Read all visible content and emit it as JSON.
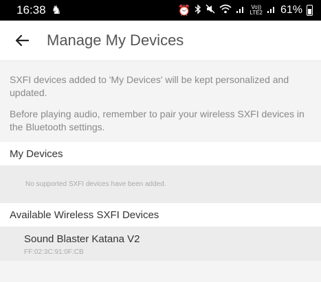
{
  "status_bar": {
    "time": "16:38",
    "left_icons": [
      "knight-icon"
    ],
    "right_icons": [
      "alarm-icon",
      "bluetooth-icon",
      "mute-icon",
      "wifi-icon",
      "signal-icon",
      "volte-icon",
      "signal2-icon"
    ],
    "volte_top": "Vo))",
    "volte_bottom": "LTE2",
    "battery": "61%"
  },
  "toolbar": {
    "title": "Manage My Devices"
  },
  "intro": {
    "line1": "SXFI devices added to 'My Devices' will be kept personalized and updated.",
    "line2": "Before playing audio, remember to pair your wireless SXFI devices in the Bluetooth settings."
  },
  "my_devices": {
    "header": "My Devices",
    "empty_message": "No supported SXFI devices have been added."
  },
  "available": {
    "header": "Available Wireless SXFI Devices",
    "devices": [
      {
        "name": "Sound Blaster Katana V2",
        "mac": "FF:02:3C:91:0F:CB"
      }
    ]
  }
}
